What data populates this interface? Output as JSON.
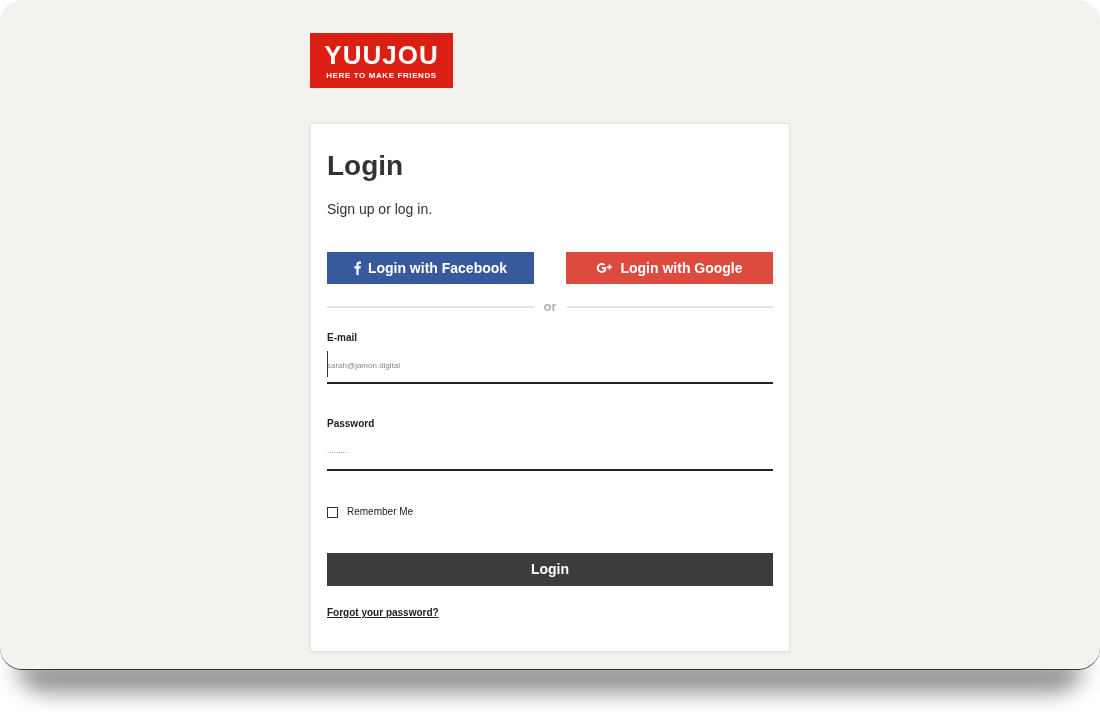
{
  "logo": {
    "name": "YUUJOU",
    "tagline": "HERE TO MAKE FRIENDS"
  },
  "login_card": {
    "title": "Login",
    "subtitle": "Sign up or log in.",
    "social_buttons": [
      {
        "kind": "facebook",
        "label": "Login with Facebook"
      },
      {
        "kind": "google",
        "label": "Login with Google"
      }
    ],
    "divider": "or",
    "fields": [
      {
        "label": "E-mail",
        "placeholder": "sarah@jamon.digital",
        "focused": true
      },
      {
        "label": "Password",
        "value": ".........",
        "focused": false
      }
    ],
    "remember_me": {
      "label": "Remember Me",
      "checked": false
    },
    "submit": "Login",
    "forgot_link": "Forgot your password?"
  }
}
